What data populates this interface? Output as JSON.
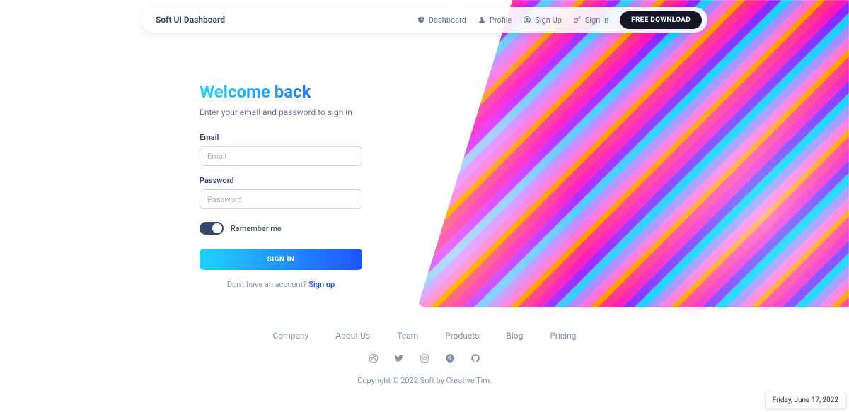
{
  "nav": {
    "brand": "Soft UI Dashboard",
    "items": [
      {
        "label": "Dashboard"
      },
      {
        "label": "Profile"
      },
      {
        "label": "Sign Up"
      },
      {
        "label": "Sign In"
      }
    ],
    "cta": "FREE DOWNLOAD"
  },
  "signin": {
    "title": "Welcome back",
    "subtitle": "Enter your email and password to sign in",
    "email_label": "Email",
    "email_placeholder": "Email",
    "password_label": "Password",
    "password_placeholder": "Password",
    "remember_label": "Remember me",
    "submit": "SIGN IN",
    "no_account": "Don't have an account? ",
    "signup_link": "Sign up"
  },
  "footer": {
    "links": [
      "Company",
      "About Us",
      "Team",
      "Products",
      "Blog",
      "Pricing"
    ],
    "copyright": "Copyright © 2022 Soft by Creative Tim."
  },
  "date_widget": "Friday, June 17, 2022"
}
